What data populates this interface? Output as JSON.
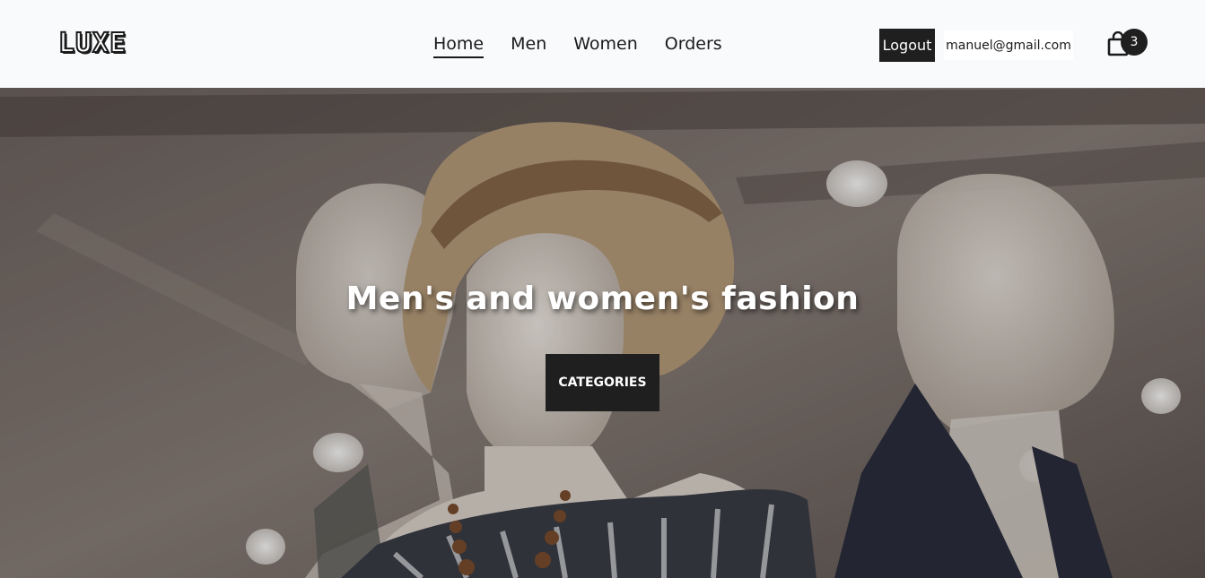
{
  "header": {
    "logo": "LUXE",
    "nav": [
      {
        "label": "Home",
        "active": true
      },
      {
        "label": "Men",
        "active": false
      },
      {
        "label": "Women",
        "active": false
      },
      {
        "label": "Orders",
        "active": false
      }
    ],
    "logout_label": "Logout",
    "user_email": "manuel@gmail.com",
    "cart_count": "3",
    "cart_icon": "shopping-bag-icon"
  },
  "hero": {
    "title": "Men's and women's fashion",
    "cta_label": "CATEGORIES"
  },
  "colors": {
    "header_bg": "#f8fafc",
    "button_bg": "#1f1f1f",
    "text": "#1a1a1a"
  }
}
